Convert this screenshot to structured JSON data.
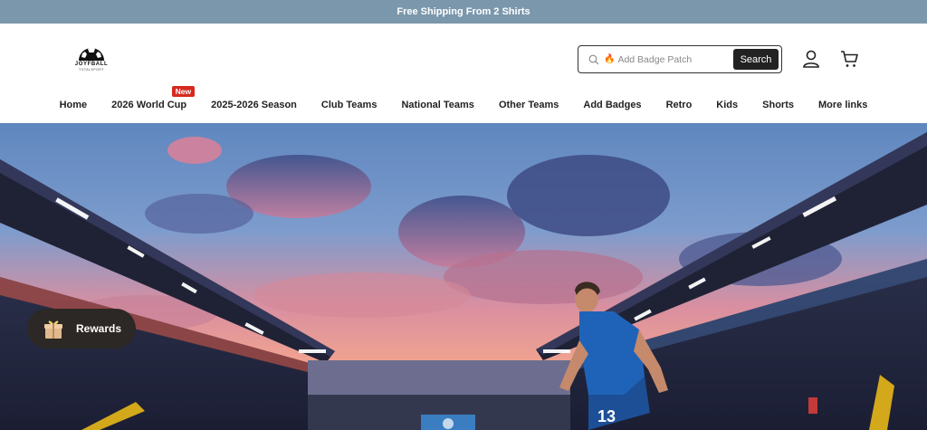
{
  "announcement": {
    "text": "Free Shipping From 2 Shirts"
  },
  "logo": {
    "name": "JOYFBALL",
    "sub": "TOTALSPORT"
  },
  "search": {
    "placeholder": "Add Badge Patch",
    "button_label": "Search"
  },
  "nav": {
    "items": [
      {
        "label": "Home"
      },
      {
        "label": "2026 World Cup",
        "badge": "New"
      },
      {
        "label": "2025-2026 Season"
      },
      {
        "label": "Club Teams"
      },
      {
        "label": "National Teams"
      },
      {
        "label": "Other Teams"
      },
      {
        "label": "Add Badges"
      },
      {
        "label": "Retro"
      },
      {
        "label": "Kids"
      },
      {
        "label": "Shorts"
      },
      {
        "label": "More links"
      }
    ]
  },
  "hero": {
    "jersey_number": "13"
  },
  "rewards": {
    "label": "Rewards"
  },
  "colors": {
    "announcement_bg": "#7b97ac",
    "badge_red": "#d62a1e",
    "button_dark": "#222222"
  }
}
